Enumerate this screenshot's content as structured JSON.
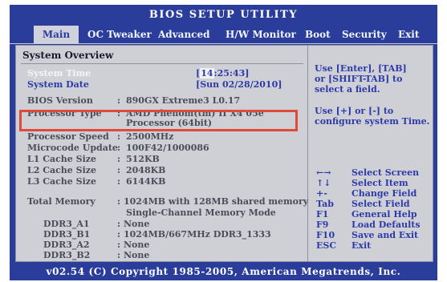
{
  "title": "BIOS SETUP UTILITY",
  "menu": [
    {
      "label": "Main",
      "active": true
    },
    {
      "label": "OC Tweaker"
    },
    {
      "label": "Advanced"
    },
    {
      "label": "H/W Monitor"
    },
    {
      "label": "Boot"
    },
    {
      "label": "Security"
    },
    {
      "label": "Exit"
    }
  ],
  "section_title": "System Overview",
  "system_time": {
    "label": "System Time",
    "value_prefix": "[",
    "cursor": "14",
    "value_rest": ":25:43]"
  },
  "system_date": {
    "label": "System Date",
    "value": "[Sun 02/28/2010]"
  },
  "info_rows": [
    {
      "label": "BIOS Version",
      "sep": ":",
      "value": "890GX Extreme3 L0.17"
    },
    {
      "label": "Processor Type",
      "sep": ":",
      "value": "AMD Phenom(tm) II X4 05e",
      "value2": "Processor (64bit)"
    },
    {
      "label": "Processor Speed",
      "sep": ":",
      "value": "2500MHz"
    },
    {
      "label": "Microcode Update",
      "sep": ":",
      "value": "100F42/1000086"
    },
    {
      "label": "L1 Cache Size",
      "sep": ":",
      "value": "512KB"
    },
    {
      "label": "L2 Cache Size",
      "sep": ":",
      "value": "2048KB"
    },
    {
      "label": "L3 Cache Size",
      "sep": ":",
      "value": "6144KB"
    }
  ],
  "memory": {
    "label": "Total Memory",
    "sep": ":",
    "value": "1024MB with 128MB shared memory",
    "value2": "Single-Channel Memory Mode",
    "slots": [
      {
        "label": "DDR3_A1",
        "sep": ":",
        "value": "None"
      },
      {
        "label": "DDR3_B1",
        "sep": ":",
        "value": "1024MB/667MHz DDR3_1333"
      },
      {
        "label": "DDR3_A2",
        "sep": ":",
        "value": "None"
      },
      {
        "label": "DDR3_B2",
        "sep": ":",
        "value": "None"
      }
    ]
  },
  "help": {
    "line1": "Use [Enter], [TAB]",
    "line2": "or [SHIFT-TAB] to",
    "line3": "select a field.",
    "line4": "Use [+] or [-] to",
    "line5": "configure system Time."
  },
  "keys": [
    {
      "key": "←→",
      "desc": "Select Screen"
    },
    {
      "key": "↑↓",
      "desc": "Select Item"
    },
    {
      "key": "+-",
      "desc": "Change Field"
    },
    {
      "key": "Tab",
      "desc": "Select Field"
    },
    {
      "key": "F1",
      "desc": "General Help"
    },
    {
      "key": "F9",
      "desc": "Load Defaults"
    },
    {
      "key": "F10",
      "desc": "Save and Exit"
    },
    {
      "key": "ESC",
      "desc": "Exit"
    }
  ],
  "footer": "v02.54 (C) Copyright 1985-2005, American Megatrends, Inc.",
  "colors": {
    "screen_bg": "#2b3d9a",
    "panel_bg": "#cfd0d6",
    "text_blue": "#2e3aa8",
    "highlight": "#e04a38"
  }
}
